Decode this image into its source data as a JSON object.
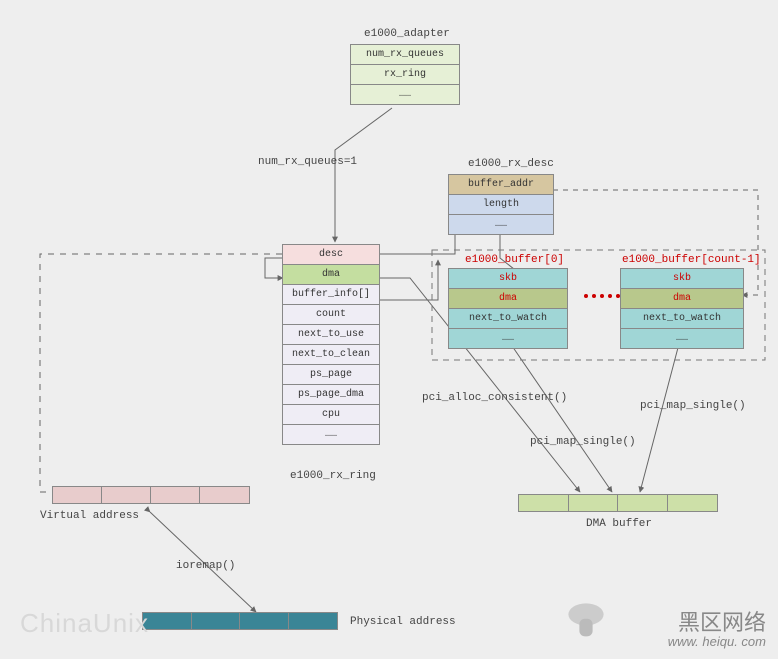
{
  "adapter": {
    "title": "e1000_adapter",
    "fields": [
      "num_rx_queues",
      "rx_ring",
      "……"
    ]
  },
  "edge_adapter": "num_rx_queues=1",
  "rx_desc": {
    "title": "e1000_rx_desc",
    "fields": [
      "buffer_addr",
      "length",
      "……"
    ]
  },
  "rx_ring": {
    "title": "e1000_rx_ring",
    "fields": [
      "desc",
      "dma",
      "buffer_info[]",
      "count",
      "next_to_use",
      "next_to_clean",
      "ps_page",
      "ps_page_dma",
      "cpu",
      "……"
    ]
  },
  "buffer0": {
    "title": "e1000_buffer[0]",
    "fields": [
      "skb",
      "dma",
      "next_to_watch",
      "……"
    ]
  },
  "bufferN": {
    "title": "e1000_buffer[count-1]",
    "fields": [
      "skb",
      "dma",
      "next_to_watch",
      "……"
    ]
  },
  "dma_buffer_label": "DMA buffer",
  "virtual_label": "Virtual address",
  "physical_label": "Physical address",
  "ioremap_label": "ioremap()",
  "pci_alloc_label": "pci_alloc_consistent()",
  "pci_map_label1": "pci_map_single()",
  "pci_map_label2": "pci_map_single()",
  "watermark": {
    "chinaunix": "ChinaUnix",
    "heiqu_cn": "黑区网络",
    "heiqu_url": "www. heiqu. com"
  },
  "chart_data": {
    "type": "diagram",
    "title": "e1000 driver RX data structures and DMA mapping",
    "structs": [
      {
        "name": "e1000_adapter",
        "members": [
          "num_rx_queues",
          "rx_ring",
          "…"
        ]
      },
      {
        "name": "e1000_rx_ring",
        "members": [
          "desc",
          "dma",
          "buffer_info[]",
          "count",
          "next_to_use",
          "next_to_clean",
          "ps_page",
          "ps_page_dma",
          "cpu",
          "…"
        ]
      },
      {
        "name": "e1000_rx_desc",
        "members": [
          "buffer_addr",
          "length",
          "…"
        ]
      },
      {
        "name": "e1000_buffer",
        "members": [
          "skb",
          "dma",
          "next_to_watch",
          "…"
        ],
        "array": true
      }
    ],
    "arrays": [
      "Virtual address",
      "Physical address",
      "DMA buffer"
    ],
    "edges": [
      {
        "from": "e1000_adapter.rx_ring",
        "to": "e1000_rx_ring",
        "label": "num_rx_queues=1"
      },
      {
        "from": "e1000_rx_ring.desc",
        "to": "e1000_rx_desc"
      },
      {
        "from": "e1000_rx_ring.dma",
        "to": "DMA buffer",
        "label": "pci_alloc_consistent()"
      },
      {
        "from": "e1000_rx_ring.buffer_info[]",
        "to": "e1000_buffer[0..count-1]"
      },
      {
        "from": "e1000_rx_desc.buffer_addr",
        "to": "e1000_buffer.dma"
      },
      {
        "from": "e1000_buffer.dma",
        "to": "DMA buffer",
        "label": "pci_map_single()"
      },
      {
        "from": "Virtual address",
        "to": "Physical address",
        "label": "ioremap()",
        "bidirectional": true
      },
      {
        "from": "e1000_rx_ring.desc",
        "to": "Virtual address"
      }
    ]
  }
}
